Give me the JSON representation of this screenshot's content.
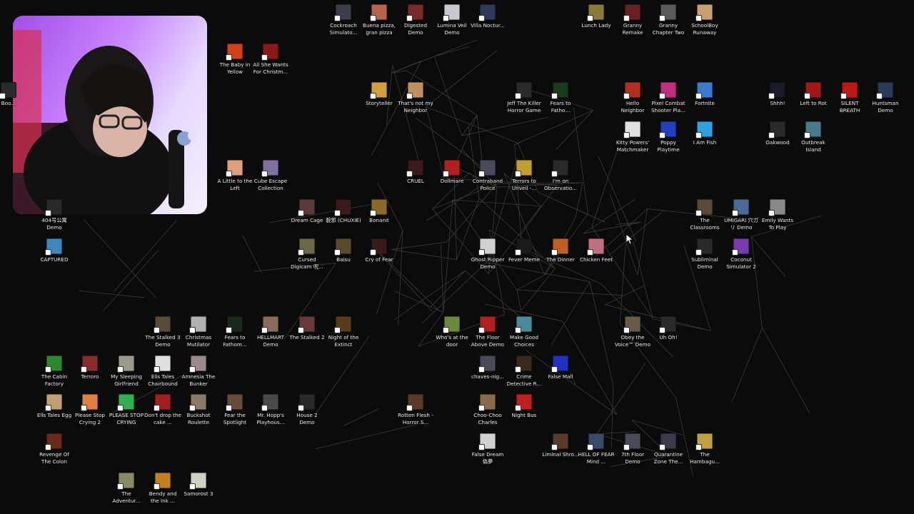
{
  "desktop": {
    "wallpaper_color": "#0b0b0c",
    "icons": [
      {
        "label": "Cockroach Simulato...",
        "color": "#3a3f4a"
      },
      {
        "label": "Buena pizza, gran pizza",
        "color": "#b5654a"
      },
      {
        "label": "Digested Demo",
        "color": "#7a2a2a"
      },
      {
        "label": "Lumina Veil Demo",
        "color": "#c8c8d0"
      },
      {
        "label": "Villa Noctur...",
        "color": "#2e3a5a"
      },
      {
        "label": "Lunch Lady",
        "color": "#8a7a3a"
      },
      {
        "label": "Granny Remake",
        "color": "#6a2020"
      },
      {
        "label": "Granny Chapter Two",
        "color": "#5a5a5a"
      },
      {
        "label": "SchoolBoy Runaway",
        "color": "#c8a070"
      },
      {
        "label": "The Baby in Yellow",
        "color": "#d0401a"
      },
      {
        "label": "All She Wants For Christm...",
        "color": "#8a1a1a"
      },
      {
        "label": "Storyteller",
        "color": "#d0a040"
      },
      {
        "label": "That's not my Neighbor",
        "color": "#c09060"
      },
      {
        "label": "Jeff The Killer Horror Game",
        "color": "#2a2a2a"
      },
      {
        "label": "Fears to Fatho...",
        "color": "#1a3a1a"
      },
      {
        "label": "Hello Neighbor",
        "color": "#b03020"
      },
      {
        "label": "Pixel Combat Shooter Pla...",
        "color": "#c03080"
      },
      {
        "label": "Fortnite",
        "color": "#3a7ad0"
      },
      {
        "label": "Shhh!",
        "color": "#1a1a2a"
      },
      {
        "label": "Left to Rot",
        "color": "#a01818"
      },
      {
        "label": "SILENT BREATH",
        "color": "#c01818"
      },
      {
        "label": "Huntsman Demo",
        "color": "#2a3a5a"
      },
      {
        "label": "Kitty Powers' Matchmaker",
        "color": "#e0e0e0"
      },
      {
        "label": "Poppy Playtime",
        "color": "#2040c0"
      },
      {
        "label": "I Am Fish",
        "color": "#30a0e0"
      },
      {
        "label": "Oakwood",
        "color": "#2a2a2a"
      },
      {
        "label": "Outbreak Island",
        "color": "#4a7a8a"
      },
      {
        "label": "A Little to the Left",
        "color": "#e0a080"
      },
      {
        "label": "Cube Escape Collection",
        "color": "#8070a0"
      },
      {
        "label": "CRUEL",
        "color": "#3a1a1a"
      },
      {
        "label": "Dollmare",
        "color": "#b02020"
      },
      {
        "label": "Contraband Police",
        "color": "#4a4a5a"
      },
      {
        "label": "Terrors to Unveil -...",
        "color": "#c0a030"
      },
      {
        "label": "I'm on Observatio...",
        "color": "#2a2a2a"
      },
      {
        "label": "The Classrooms",
        "color": "#5a4a3a"
      },
      {
        "label": "UMIGARI 穴ガリ Demo",
        "color": "#4a6a9a"
      },
      {
        "label": "Emily Wants To Play",
        "color": "#8a8a8a"
      },
      {
        "label": "Dream Cage",
        "color": "#5a3a3a"
      },
      {
        "label": "貌邪 (CHUXIE)",
        "color": "#3a1a1a"
      },
      {
        "label": "Bonanit",
        "color": "#8a6a2a"
      },
      {
        "label": "Cursed Digicam 呪...",
        "color": "#6a6a4a"
      },
      {
        "label": "Baisu",
        "color": "#5a4a2a"
      },
      {
        "label": "Cry of Fear",
        "color": "#3a1a1a"
      },
      {
        "label": "Ghost Ripper Demo",
        "color": "#d0d0d0"
      },
      {
        "label": "Fever Meme",
        "color": "#1a1a1a"
      },
      {
        "label": "The Dinner",
        "color": "#c06020"
      },
      {
        "label": "Chicken Feet",
        "color": "#c07080"
      },
      {
        "label": "Subliminal Demo",
        "color": "#2a2a2a"
      },
      {
        "label": "Coconut Simulator 2",
        "color": "#7a3ab0"
      },
      {
        "label": "404号公寓 Demo",
        "color": "#2a2a2a"
      },
      {
        "label": "CAPTURED",
        "color": "#3a8ac0"
      },
      {
        "label": "The Stalked 3 Demo",
        "color": "#5a4a3a"
      },
      {
        "label": "Christmas Mutilator",
        "color": "#b0b0b0"
      },
      {
        "label": "Fears to Fathom...",
        "color": "#1a2a1a"
      },
      {
        "label": "HELLMART Demo",
        "color": "#8a6a5a"
      },
      {
        "label": "The Stalked 2",
        "color": "#6a3a3a"
      },
      {
        "label": "Night of the Extinct",
        "color": "#5a3a1a"
      },
      {
        "label": "Who's at the door",
        "color": "#6a8a3a"
      },
      {
        "label": "The Floor Above Demo",
        "color": "#b02020"
      },
      {
        "label": "Make Good Choices",
        "color": "#4a8a9a"
      },
      {
        "label": "Obey the Voice™ Demo",
        "color": "#6a5a4a"
      },
      {
        "label": "Uh Oh!",
        "color": "#2a2a2a"
      },
      {
        "label": "The Cabin Factory",
        "color": "#2a8a2a"
      },
      {
        "label": "Terroro",
        "color": "#8a2a2a"
      },
      {
        "label": "My Sleeping Girlfriend",
        "color": "#9a9a8a"
      },
      {
        "label": "Ells Tales Chairbound",
        "color": "#e0e0e0"
      },
      {
        "label": "Amnesia The Bunker",
        "color": "#9a8a8a"
      },
      {
        "label": "chaves-nig...",
        "color": "#4a4a5a"
      },
      {
        "label": "Crime Detective R...",
        "color": "#3a2a1a"
      },
      {
        "label": "False Mall",
        "color": "#2030c0"
      },
      {
        "label": "Ells Tales Egg",
        "color": "#c0a070"
      },
      {
        "label": "Please Stop Crying 2",
        "color": "#e08040"
      },
      {
        "label": "PLEASE STOP CRYING",
        "color": "#30b050"
      },
      {
        "label": "Don't drop the cake ...",
        "color": "#a02020"
      },
      {
        "label": "Buckshot Roulette",
        "color": "#8a7a6a"
      },
      {
        "label": "Fear the Spotlight",
        "color": "#6a4a3a"
      },
      {
        "label": "Mr. Hopp's Playhous...",
        "color": "#4a4a4a"
      },
      {
        "label": "House 2 Demo",
        "color": "#2a2a2a"
      },
      {
        "label": "Rotten Flesh - Horror S...",
        "color": "#5a3a2a"
      },
      {
        "label": "Choo-Choo Charles",
        "color": "#8a6a4a"
      },
      {
        "label": "Night Bus",
        "color": "#c02020"
      },
      {
        "label": "Revenge Of The Colon",
        "color": "#6a2a1a"
      },
      {
        "label": "False Dream 偽夢",
        "color": "#d0d0d0"
      },
      {
        "label": "Liminal Shro...",
        "color": "#5a3a2a"
      },
      {
        "label": "HELL OF FEAR Mind ...",
        "color": "#3a4a6a"
      },
      {
        "label": "7th Floor Demo",
        "color": "#4a4a5a"
      },
      {
        "label": "Quarantine Zone The...",
        "color": "#3a3a4a"
      },
      {
        "label": "The Hambagu...",
        "color": "#c0a040"
      },
      {
        "label": "The Adventur...",
        "color": "#8a8a6a"
      },
      {
        "label": "Bendy and the Ink ...",
        "color": "#c08020"
      },
      {
        "label": "Samorost 3",
        "color": "#d0d0c0"
      },
      {
        "label": "Boo...",
        "color": "#2a2a2a"
      }
    ]
  }
}
